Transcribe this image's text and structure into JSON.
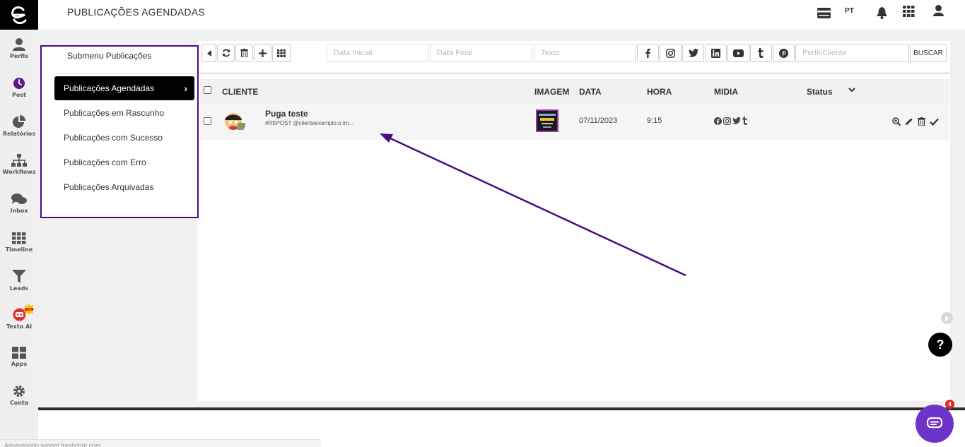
{
  "header": {
    "title": "PUBLICAÇÕES AGENDADAS",
    "lang": "PT"
  },
  "rail": {
    "items": [
      {
        "label": "Perfis",
        "icon": "user-icon"
      },
      {
        "label": "Post",
        "icon": "clock-icon"
      },
      {
        "label": "Relatórios",
        "icon": "pie-chart-icon"
      },
      {
        "label": "Workflows",
        "icon": "sitemap-icon"
      },
      {
        "label": "Inbox",
        "icon": "chat-bubbles-icon"
      },
      {
        "label": "Timeline",
        "icon": "grid-icon"
      },
      {
        "label": "Leads",
        "icon": "filter-icon"
      },
      {
        "label": "Texto AI",
        "icon": "robot-icon",
        "badge": "NEW"
      },
      {
        "label": "Apps",
        "icon": "apps-icon"
      },
      {
        "label": "Conta",
        "icon": "gear-icon"
      }
    ]
  },
  "submenu": {
    "title": "Submenu Publicações",
    "items": [
      {
        "label": "Publicações Agendadas",
        "active": true
      },
      {
        "label": "Publicações em Rascunho",
        "active": false
      },
      {
        "label": "Publicações com Sucesso",
        "active": false
      },
      {
        "label": "Publicações com Erro",
        "active": false
      },
      {
        "label": "Publicações Arquivadas",
        "active": false
      }
    ]
  },
  "filters": {
    "start_date_placeholder": "Data Inicial",
    "end_date_placeholder": "Data Final",
    "text_placeholder": "Texto",
    "profile_placeholder": "Perfil/Cliente",
    "search_label": "BUSCAR"
  },
  "table": {
    "headers": {
      "client": "CLIENTE",
      "image": "IMAGEM",
      "date": "DATA",
      "hour": "HORA",
      "media": "MIDIA",
      "status": "Status"
    },
    "rows": [
      {
        "client": "Puga teste",
        "caption": "#REPOST @clienteexemplo.o im...",
        "date": "07/11/2023",
        "hour": "9:15",
        "media": [
          "facebook",
          "instagram",
          "twitter",
          "tumblr"
        ]
      }
    ]
  },
  "help_label": "?",
  "chat_badge_count": "4",
  "status_bar_text": "Aguardando widget.freshchat.com...",
  "colors": {
    "accent_purple": "#4b0a82",
    "chat_purple": "#6e34c9",
    "post_icon": "#5b1a8a",
    "ai_red": "#e03030"
  }
}
